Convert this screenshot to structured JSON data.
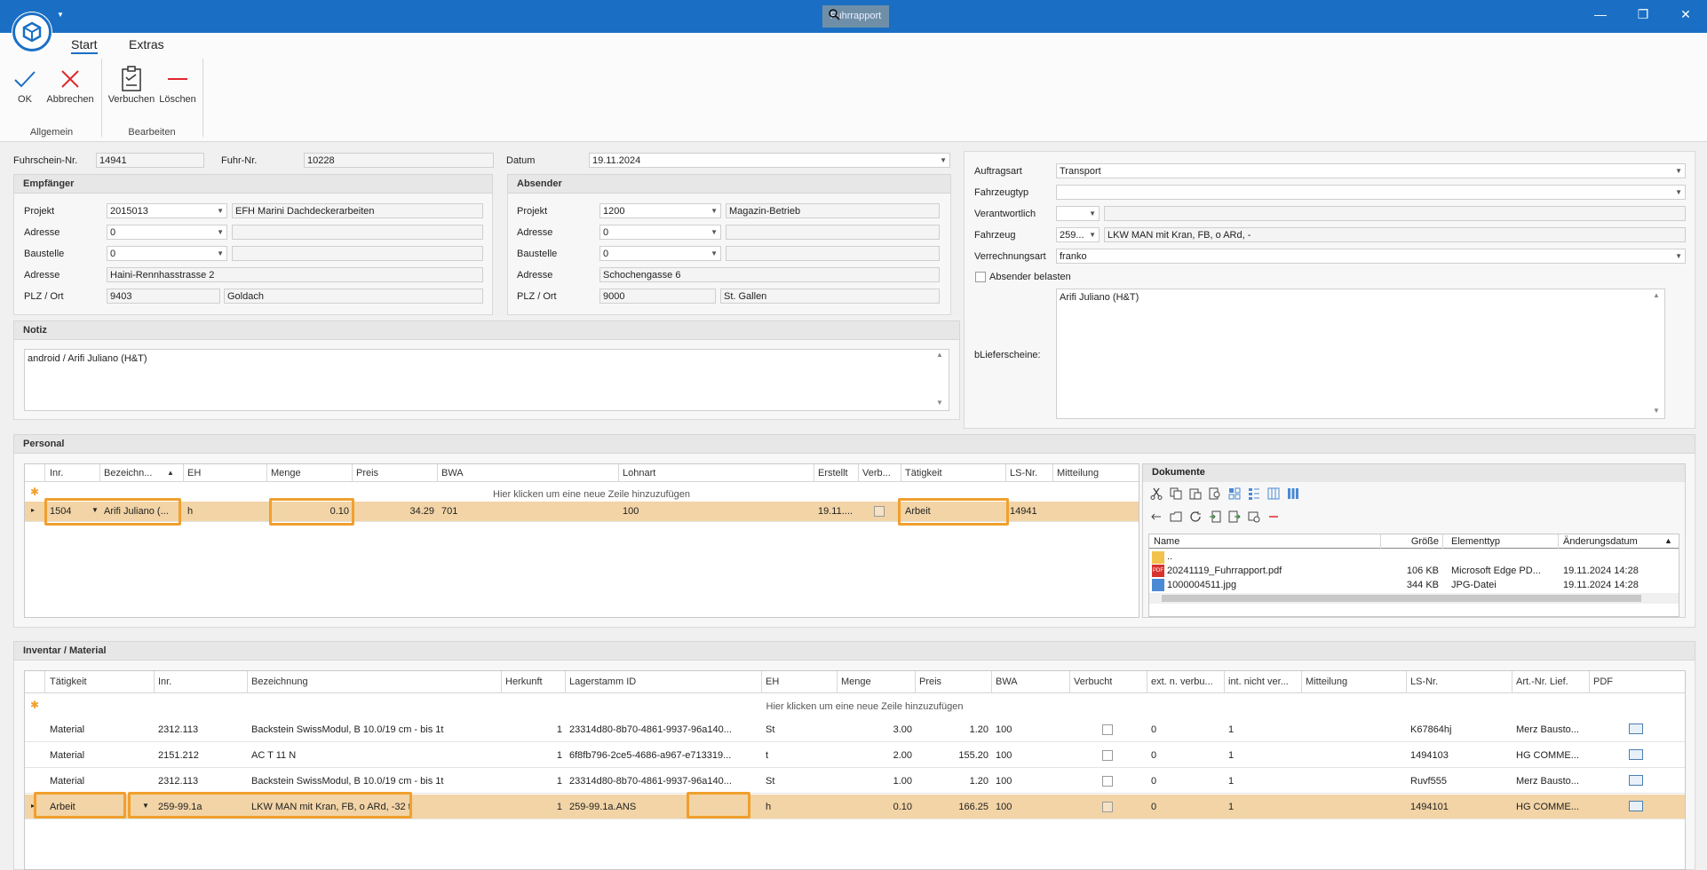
{
  "window": {
    "title": "Fuhrrapport",
    "minimize": "—",
    "restore": "❐",
    "close": "✕"
  },
  "ribbon": {
    "tabs": [
      "Start",
      "Extras"
    ],
    "buttons": {
      "ok": "OK",
      "cancel": "Abbrechen",
      "book": "Verbuchen",
      "delete": "Löschen"
    },
    "groups": [
      "Allgemein",
      "Bearbeiten"
    ]
  },
  "header": {
    "fuhrschein_label": "Fuhrschein-Nr.",
    "fuhrschein_value": "14941",
    "fuhr_label": "Fuhr-Nr.",
    "fuhr_value": "10228",
    "datum_label": "Datum",
    "datum_value": "19.11.2024"
  },
  "empfaenger": {
    "title": "Empfänger",
    "projekt_label": "Projekt",
    "projekt_value": "2015013",
    "projekt_name": "EFH Marini Dachdeckerarbeiten",
    "adresse_label": "Adresse",
    "adresse_value": "0",
    "baustelle_label": "Baustelle",
    "baustelle_value": "0",
    "adresse2_label": "Adresse",
    "adresse2_value": "Haini-Rennhasstrasse 2",
    "plz_label": "PLZ / Ort",
    "plz_value": "9403",
    "ort_value": "Goldach"
  },
  "absender": {
    "title": "Absender",
    "projekt_label": "Projekt",
    "projekt_value": "1200",
    "projekt_name": "Magazin-Betrieb",
    "adresse_label": "Adresse",
    "adresse_value": "0",
    "baustelle_label": "Baustelle",
    "baustelle_value": "0",
    "adresse2_label": "Adresse",
    "adresse2_value": "Schochengasse 6",
    "plz_label": "PLZ / Ort",
    "plz_value": "9000",
    "ort_value": "St. Gallen"
  },
  "right_panel": {
    "auftragsart_label": "Auftragsart",
    "auftragsart_value": "Transport",
    "fahrzeugtyp_label": "Fahrzeugtyp",
    "fahrzeugtyp_value": "",
    "verantwortlich_label": "Verantwortlich",
    "verantwortlich_value": "",
    "fahrzeug_label": "Fahrzeug",
    "fahrzeug_value": "259...",
    "fahrzeug_name": "LKW MAN mit Kran, FB, o ARd, -",
    "verrechnungsart_label": "Verrechnungsart",
    "verrechnungsart_value": "franko",
    "absender_belasten_label": "Absender belasten",
    "lieferscheine_label": "bLieferscheine:",
    "lieferscheine_value": "Arifi Juliano (H&T)"
  },
  "notiz": {
    "title": "Notiz",
    "value": "android / Arifi Juliano (H&T)"
  },
  "personal": {
    "title": "Personal",
    "columns": [
      "Inr.",
      "Bezeichn...",
      "EH",
      "Menge",
      "Preis",
      "BWA",
      "Lohnart",
      "Erstellt",
      "Verb...",
      "Tätigkeit",
      "LS-Nr.",
      "Mitteilung"
    ],
    "new_row_text": "Hier klicken um eine neue Zeile hinzuzufügen",
    "rows": [
      {
        "inr": "1504",
        "bez": "Arifi Juliano (...",
        "eh": "h",
        "menge": "0.10",
        "preis": "34.29",
        "bwa": "701",
        "lohnart": "100",
        "erstellt": "19.11....",
        "taetigkeit": "Arbeit",
        "ls": "14941",
        "mitteilung": ""
      }
    ]
  },
  "dokumente": {
    "title": "Dokumente",
    "columns": [
      "Name",
      "Größe",
      "Elementtyp",
      "Änderungsdatum"
    ],
    "files": [
      {
        "name": "..",
        "size": "",
        "type": "",
        "date": ""
      },
      {
        "name": "20241119_Fuhrrapport.pdf",
        "size": "106 KB",
        "type": "Microsoft Edge PD...",
        "date": "19.11.2024 14:28"
      },
      {
        "name": "1000004511.jpg",
        "size": "344 KB",
        "type": "JPG-Datei",
        "date": "19.11.2024 14:28"
      }
    ]
  },
  "inventar": {
    "title": "Inventar / Material",
    "columns": [
      "Tätigkeit",
      "Inr.",
      "Bezeichnung",
      "Herkunft",
      "Lagerstamm ID",
      "EH",
      "Menge",
      "Preis",
      "BWA",
      "Verbucht",
      "ext. n. verbu...",
      "int. nicht ver...",
      "Mitteilung",
      "LS-Nr.",
      "Art.-Nr. Lief.",
      "PDF"
    ],
    "new_row_text": "Hier klicken um eine neue Zeile hinzuzufügen",
    "rows": [
      {
        "t": "Material",
        "inr": "2312.113",
        "bez": "Backstein SwissModul, B 10.0/19 cm - bis 1t",
        "herk": "1",
        "lag": "23314d80-8b70-4861-9937-96a140...",
        "eh": "St",
        "menge": "3.00",
        "preis": "1.20",
        "bwa": "100",
        "ext": "0",
        "int": "1",
        "mit": "",
        "ls": "K67864hj",
        "art": "Merz Bausto..."
      },
      {
        "t": "Material",
        "inr": "2151.212",
        "bez": "AC T 11 N",
        "herk": "1",
        "lag": "6f8fb796-2ce5-4686-a967-e713319...",
        "eh": "t",
        "menge": "2.00",
        "preis": "155.20",
        "bwa": "100",
        "ext": "0",
        "int": "1",
        "mit": "",
        "ls": "1494103",
        "art": "HG COMME..."
      },
      {
        "t": "Material",
        "inr": "2312.113",
        "bez": "Backstein SwissModul, B 10.0/19 cm - bis 1t",
        "herk": "1",
        "lag": "23314d80-8b70-4861-9937-96a140...",
        "eh": "St",
        "menge": "1.00",
        "preis": "1.20",
        "bwa": "100",
        "ext": "0",
        "int": "1",
        "mit": "",
        "ls": "Ruvf555",
        "art": "Merz Bausto..."
      },
      {
        "t": "Arbeit",
        "inr": "259-99.1a",
        "bez": "LKW MAN mit Kran, FB, o ARd, -32 t",
        "herk": "1",
        "lag": "259-99.1a.ANS",
        "eh": "h",
        "menge": "0.10",
        "preis": "166.25",
        "bwa": "100",
        "ext": "0",
        "int": "1",
        "mit": "",
        "ls": "1494101",
        "art": "HG COMME..."
      }
    ]
  },
  "colors": {
    "title_bar": "#1a6fc4",
    "highlight_border": "#f0a02e",
    "selected_row": "#f2d4a6"
  }
}
